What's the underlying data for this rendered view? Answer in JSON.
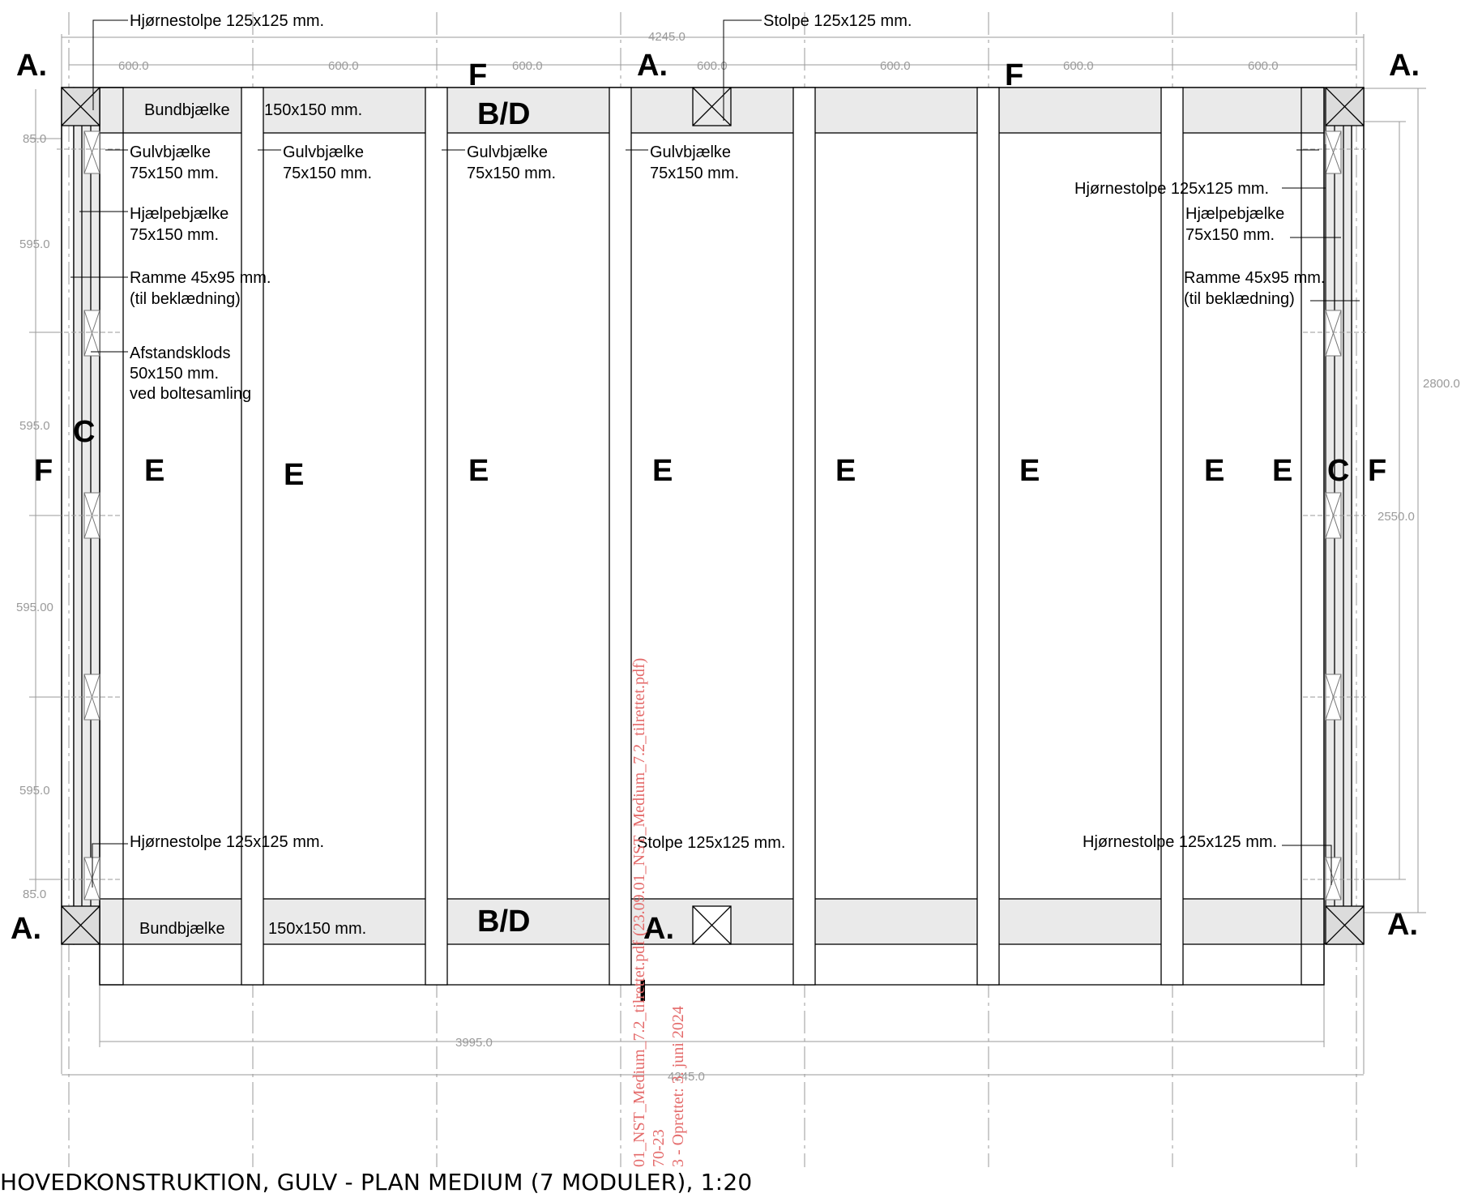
{
  "title": "HOVEDKONSTRUKTION, GULV - PLAN MEDIUM (7 MODULER), 1:20",
  "dimensions": {
    "overall_width_top": "4245.0",
    "overall_width_bottom": "4245.0",
    "inner_width": "3995.0",
    "module_widths": [
      "600.0",
      "600.0",
      "600.0",
      "600.0",
      "600.0",
      "600.0",
      "600.0"
    ],
    "left_chain": [
      "85.0",
      "595.0",
      "595.0",
      "595.00",
      "595.0",
      "85.0"
    ],
    "right_overall": "2800.0",
    "right_inner": "2550.0"
  },
  "labels": {
    "corner_post_tl": "Hjørnestolpe 125x125 mm.",
    "post_top": "Stolpe 125x125 mm.",
    "corner_post_tr": "Hjørnestolpe 125x125 mm.",
    "corner_post_bl": "Hjørnestolpe 125x125 mm.",
    "post_bottom": "Stolpe 125x125 mm.",
    "corner_post_br": "Hjørnestolpe 125x125 mm.",
    "sill_top_name": "Bundbjælke",
    "sill_top_size": "150x150 mm.",
    "sill_bottom_name": "Bundbjælke",
    "sill_bottom_size": "150x150 mm.",
    "floor_joists": [
      {
        "l1": "Gulvbjælke",
        "l2": "75x150 mm."
      },
      {
        "l1": "Gulvbjælke",
        "l2": "75x150 mm."
      },
      {
        "l1": "Gulvbjælke",
        "l2": "75x150 mm."
      },
      {
        "l1": "Gulvbjælke",
        "l2": "75x150 mm."
      }
    ],
    "aux_left_1": "Hjælpebjælke",
    "aux_left_2": "75x150 mm.",
    "aux_right_1": "Hjælpebjælke",
    "aux_right_2": "75x150 mm.",
    "frame_left_1": "Ramme 45x95 mm.",
    "frame_left_2": "(til beklædning)",
    "frame_right_1": "Ramme 45x95 mm.",
    "frame_right_2": "(til beklædning)",
    "spacer_1": "Afstandsklods",
    "spacer_2": "50x150 mm.",
    "spacer_3": "ved boltesamling"
  },
  "section_marks": {
    "a": "A.",
    "bd": "B/D",
    "c": "C",
    "e": "E",
    "f": "F",
    "i": "I"
  },
  "stamp": {
    "line1": "01_NST_Medium_7.2_tilrettet.pdf (23.09.01_NST_Medium_7.2_tilrettet.pdf)",
    "line2": "70-23",
    "line3": "3 - Oprettet: 3. juni 2024"
  },
  "colors": {
    "line": "#000000",
    "beam_fill": "#eaeaea",
    "dimension": "#9a9a9a",
    "stamp": "#e46a6a"
  }
}
